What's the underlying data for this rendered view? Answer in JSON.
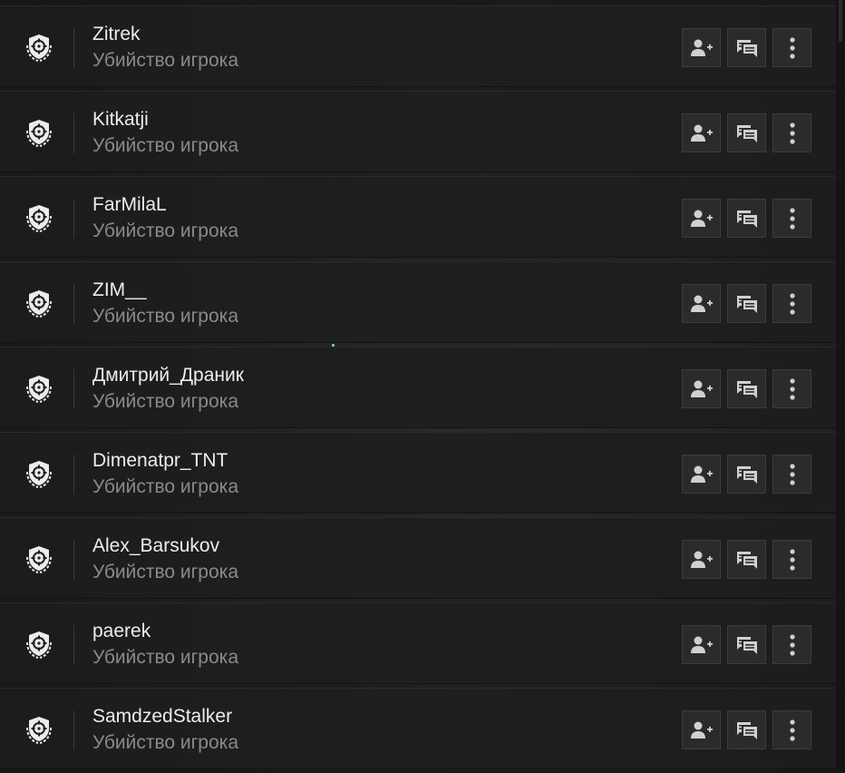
{
  "players": [
    {
      "name": "Zitrek",
      "status": "Убийство игрока"
    },
    {
      "name": "Kitkatji",
      "status": "Убийство игрока"
    },
    {
      "name": "FarMilaL",
      "status": "Убийство игрока"
    },
    {
      "name": "ZIM__",
      "status": "Убийство игрока"
    },
    {
      "name": "Дмитрий_Драник",
      "status": "Убийство игрока"
    },
    {
      "name": "Dimenatpr_TNT",
      "status": "Убийство игрока"
    },
    {
      "name": "Alex_Barsukov",
      "status": "Убийство игрока"
    },
    {
      "name": "paerek",
      "status": "Убийство игрока"
    },
    {
      "name": "SamdzedStalker",
      "status": "Убийство игрока"
    }
  ],
  "icons": {
    "badge": "shield-crosshair-laurel-icon",
    "add_friend": "add-friend-icon",
    "message": "chat-bubbles-icon",
    "more": "more-vertical-icon"
  },
  "colors": {
    "name": "#ededed",
    "status": "#8a8a8a",
    "button_bg": "#2b2b2b",
    "icon": "#d0d0d0"
  }
}
